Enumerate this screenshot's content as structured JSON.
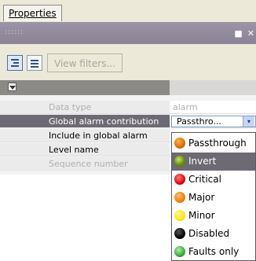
{
  "tab": {
    "label": "Properties"
  },
  "titlebar": {
    "grip": "::::::"
  },
  "toolbar": {
    "view_filters_label": "View filters..."
  },
  "properties": [
    {
      "name": "Data type",
      "value": "alarm",
      "disabled": true
    },
    {
      "name": "Global alarm contribution",
      "value": "Passthro...",
      "selected": true
    },
    {
      "name": "Include in global alarm",
      "value": ""
    },
    {
      "name": "Level name",
      "value": ""
    },
    {
      "name": "Sequence number",
      "value": "",
      "disabled": true
    }
  ],
  "dropdown": {
    "options": [
      {
        "label": "Passthrough",
        "color": "#e08a00",
        "icon": "orange-green-circle-icon"
      },
      {
        "label": "Invert",
        "color": "#5a8a00",
        "icon": "olive-circle-icon",
        "highlighted": true
      },
      {
        "label": "Critical",
        "color": "#e00000",
        "icon": "red-circle-icon"
      },
      {
        "label": "Major",
        "color": "#ee7a00",
        "icon": "orange-circle-icon"
      },
      {
        "label": "Minor",
        "color": "#ffe600",
        "icon": "yellow-circle-icon"
      },
      {
        "label": "Disabled",
        "color": "#000000",
        "icon": "black-circle-icon"
      },
      {
        "label": "Faults only",
        "color": "#2fa82f",
        "icon": "green-circle-icon"
      }
    ]
  }
}
